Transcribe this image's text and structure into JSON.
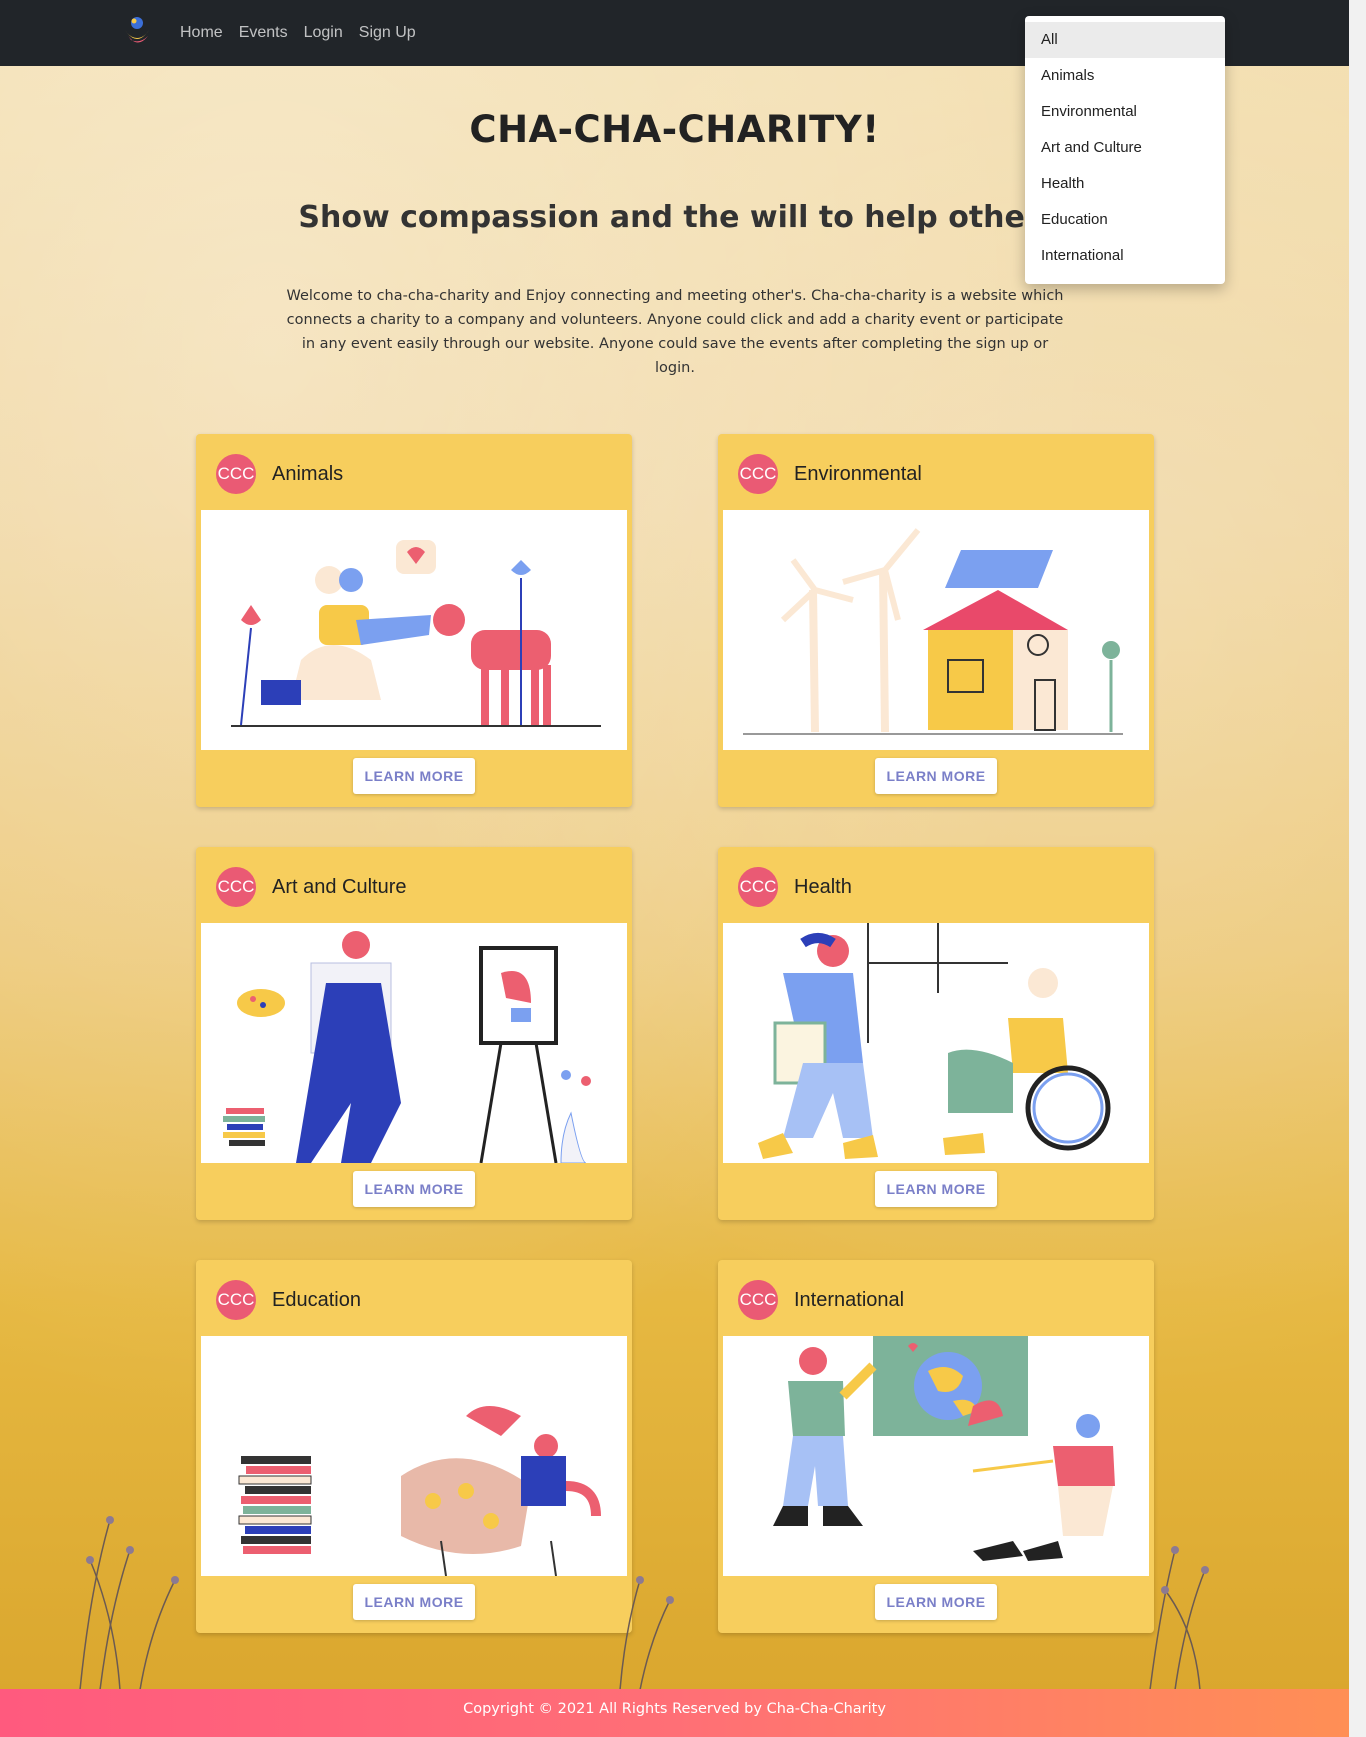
{
  "nav": {
    "links": [
      "Home",
      "Events",
      "Login",
      "Sign Up"
    ]
  },
  "category_dropdown": {
    "selected": "All",
    "options": [
      "All",
      "Animals",
      "Environmental",
      "Art and Culture",
      "Health",
      "Education",
      "International"
    ]
  },
  "hero": {
    "title": "CHA-CHA-CHARITY!",
    "subtitle": "Show compassion and the will to help other|",
    "description": "Welcome to cha-cha-charity and Enjoy connecting and meeting other's. Cha-cha-charity is a website which connects a charity to a company and volunteers. Anyone could click and add a charity event or participate in any event easily through our website. Anyone could save the events after completing the sign up or login."
  },
  "cards": [
    {
      "avatar": "CCC",
      "title": "Animals",
      "button": "LEARN MORE"
    },
    {
      "avatar": "CCC",
      "title": "Environmental",
      "button": "LEARN MORE"
    },
    {
      "avatar": "CCC",
      "title": "Art and Culture",
      "button": "LEARN MORE"
    },
    {
      "avatar": "CCC",
      "title": "Health",
      "button": "LEARN MORE"
    },
    {
      "avatar": "CCC",
      "title": "Education",
      "button": "LEARN MORE"
    },
    {
      "avatar": "CCC",
      "title": "International",
      "button": "LEARN MORE"
    }
  ],
  "footer": {
    "text": "Copyright © 2021 All Rights Reserved by Cha-Cha-Charity"
  },
  "colors": {
    "navbar": "#212529",
    "card": "#f7ce5d",
    "avatar": "#ea5a74",
    "button_text": "#7a7fc8",
    "footer_start": "#ff5a7e",
    "footer_end": "#ff8f55"
  }
}
